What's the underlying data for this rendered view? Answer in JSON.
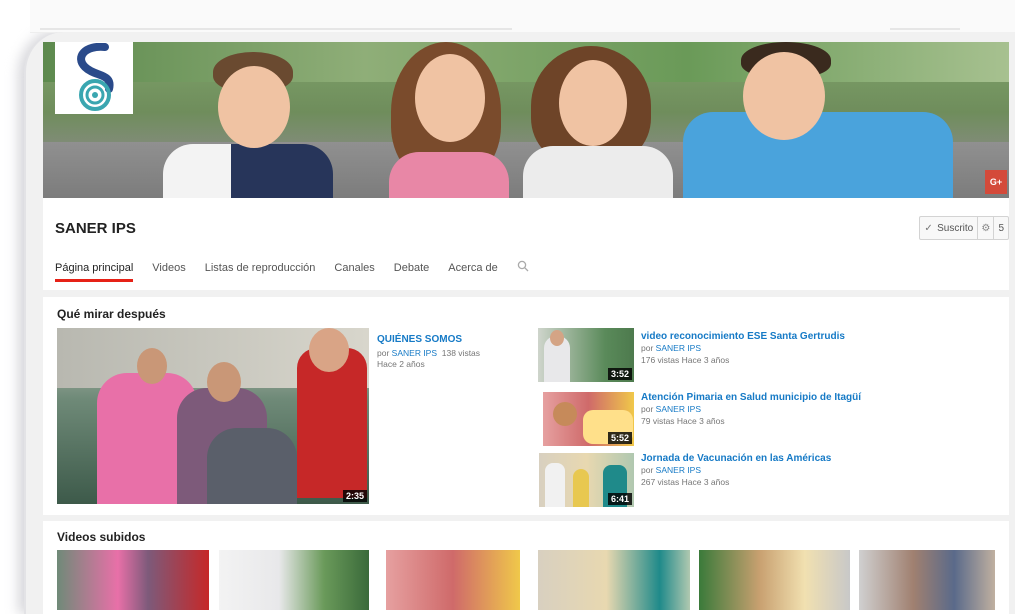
{
  "channel": {
    "name": "SANER IPS",
    "subscribe_label": "Suscrito",
    "subscriber_count": "5"
  },
  "tabs": [
    {
      "label": "Página principal"
    },
    {
      "label": "Videos"
    },
    {
      "label": "Listas de reproducción"
    },
    {
      "label": "Canales"
    },
    {
      "label": "Debate"
    },
    {
      "label": "Acerca de"
    }
  ],
  "watch_next": {
    "title": "Qué mirar después",
    "featured": {
      "title": "QUIÉNES SOMOS",
      "by_prefix": "por",
      "author": "SANER IPS",
      "views": "138 vistas",
      "age": "Hace 2 años",
      "duration": "2:35"
    },
    "videos": [
      {
        "title": "video reconocimiento ESE Santa Gertrudis",
        "by_prefix": "por",
        "author": "SANER IPS",
        "stats": "176 vistas  Hace 3 años",
        "duration": "3:52"
      },
      {
        "title": "Atención Pimaria en Salud municipio de Itagüí",
        "by_prefix": "por",
        "author": "SANER IPS",
        "stats": "79 vistas  Hace 3 años",
        "duration": "5:52"
      },
      {
        "title": "Jornada de Vacunación en las Américas",
        "by_prefix": "por",
        "author": "SANER IPS",
        "stats": "267 vistas  Hace 3 años",
        "duration": "6:41"
      }
    ]
  },
  "uploads": {
    "title": "Videos subidos"
  },
  "colors": {
    "accent_red": "#e62117",
    "link_blue": "#167ac6",
    "gplus_red": "#d44a3a"
  },
  "icons": {
    "gplus": "G+",
    "search": "search-icon",
    "check": "check-icon",
    "gear": "gear-icon"
  }
}
